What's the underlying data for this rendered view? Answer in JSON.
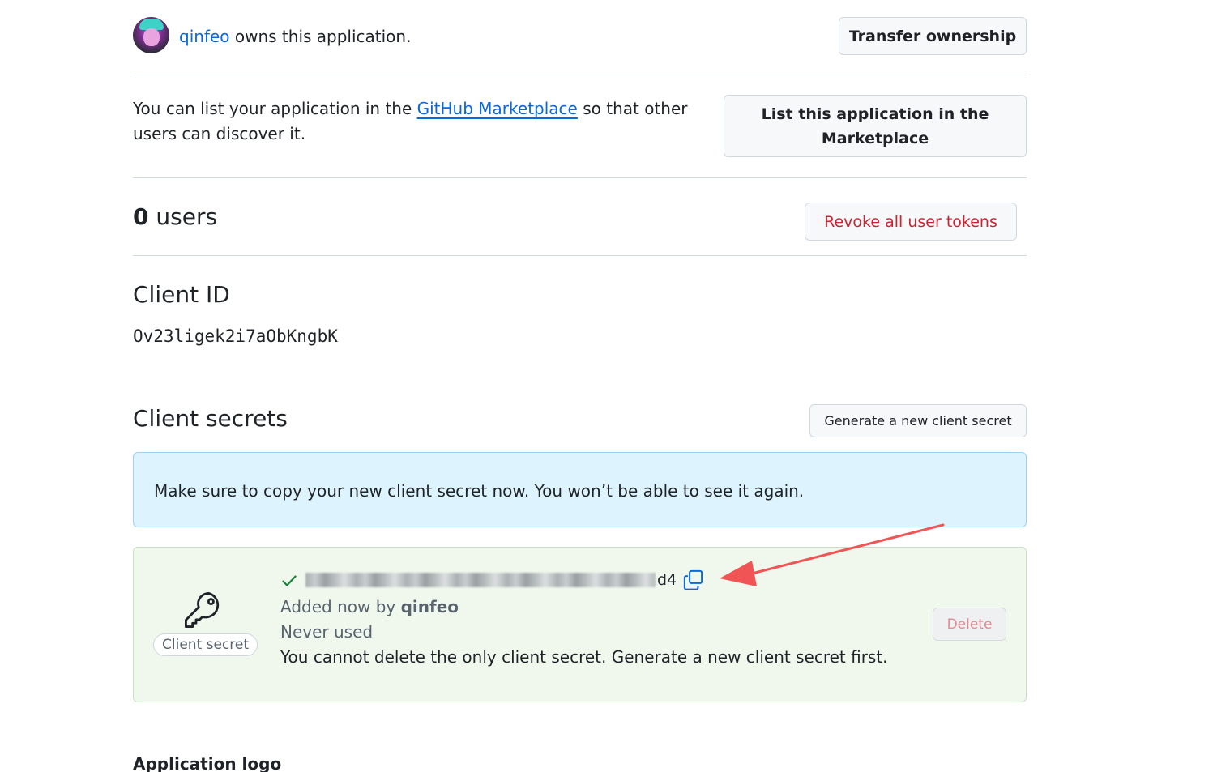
{
  "owner": {
    "username": "qinfeo",
    "suffix": " owns this application.",
    "transfer_label": "Transfer ownership"
  },
  "marketplace": {
    "text_before": "You can list your application in the ",
    "link_text": "GitHub Marketplace",
    "text_after": " so that other users can discover it.",
    "button_label": "List this application in the Marketplace"
  },
  "users": {
    "count": "0",
    "label": " users",
    "revoke_label": "Revoke all user tokens"
  },
  "client_id": {
    "title": "Client ID",
    "value": "Ov23ligek2i7aObKngbK"
  },
  "client_secrets": {
    "title": "Client secrets",
    "generate_label": "Generate a new client secret",
    "flash_message": "Make sure to copy your new client secret now. You won’t be able to see it again.",
    "secret": {
      "badge_label": "Client secret",
      "value_visible_tail": "d4",
      "added_prefix": "Added now by ",
      "added_by": "qinfeo",
      "usage": "Never used",
      "note": "You cannot delete the only client secret. Generate a new client secret first.",
      "delete_label": "Delete"
    }
  },
  "application_logo": {
    "title": "Application logo"
  },
  "colors": {
    "link": "#0969da",
    "danger": "#cf222e",
    "flash_bg": "#ddf4ff",
    "success_bg": "#f0f8ee",
    "success_icon": "#1a7f37",
    "arrow": "#f05454"
  },
  "icons": {
    "check": "check-icon",
    "key": "key-icon",
    "copy": "copy-icon",
    "annotation": "arrow-annotation"
  }
}
